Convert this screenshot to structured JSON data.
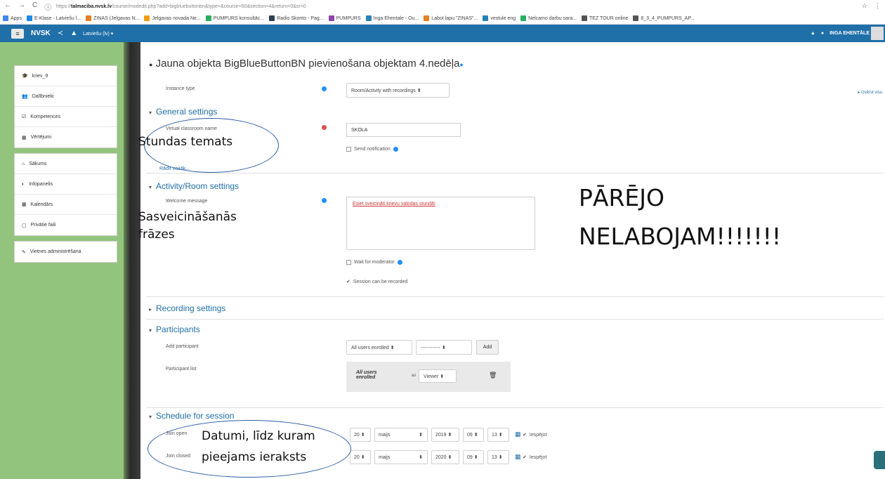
{
  "browser": {
    "nav_icons": [
      "←",
      "→",
      "C",
      "ⓘ"
    ],
    "url_prefix": "https://",
    "url_host": "talmaciba.nvsk.lv",
    "url_path": "/course/modedit.php?add=bigbluebuttonbn&type=&course=50&section=4&return=0&sr=0",
    "right_icons": [
      "☆",
      "⋮"
    ],
    "bookmarks": [
      {
        "label": "Apps",
        "color": "#4285f4"
      },
      {
        "label": "E-Klase - Latviešu l...",
        "color": "#1e88e5"
      },
      {
        "label": "ZIŅAS (Jelgavas N...",
        "color": "#e67e22"
      },
      {
        "label": "Jelgavas novada Ne...",
        "color": "#f39c12"
      },
      {
        "label": "PUMPURS konsultāc...",
        "color": "#27ae60"
      },
      {
        "label": "Radio Skonto - Pag...",
        "color": "#2c3e50"
      },
      {
        "label": "PUMPURS",
        "color": "#8e44ad"
      },
      {
        "label": "Inga Ehentale - Ou...",
        "color": "#2980b9"
      },
      {
        "label": "Labot lapu \"ZIŅAS\"...",
        "color": "#e67e22"
      },
      {
        "label": "vestule eng",
        "color": "#2980b9"
      },
      {
        "label": "Nelcamo darbu sara...",
        "color": "#27ae60"
      },
      {
        "label": "TEZ TOUR online",
        "color": "#555"
      },
      {
        "label": "8_3_4_PUMPURS_AP...",
        "color": "#555"
      }
    ]
  },
  "navbar": {
    "menu_icon": "≡",
    "brand": "NVSK",
    "share_icon": "≺",
    "site_icon": "▲",
    "language": "Latviešu (lv) ▾",
    "bell": "▲",
    "chat": "●",
    "user_name": "INGA EHENTĀLE"
  },
  "sidebar": {
    "block1": [
      {
        "icon": "🎓",
        "label": "kriev_9"
      },
      {
        "icon": "👥",
        "label": "Dalībnieki"
      },
      {
        "icon": "☑",
        "label": "Kompetences"
      },
      {
        "icon": "▦",
        "label": "Vērtējumi"
      }
    ],
    "block2": [
      {
        "icon": "⌂",
        "label": "Sākums"
      },
      {
        "icon": "◐",
        "label": "Infopanelis"
      },
      {
        "icon": "▦",
        "label": "Kalendārs"
      },
      {
        "icon": "▢",
        "label": "Privātie faili"
      }
    ],
    "block3": [
      {
        "icon": "✎",
        "label": "Vietnes administrēšana"
      }
    ]
  },
  "form": {
    "title": "Jauna objekta BigBlueButtonBN pievienošana objektam 4.nedēļa",
    "expand_all": "▸ Izvērst visu",
    "instance_type_label": "Instance type",
    "instance_type_value": "Room/Activity with recordings ⬍",
    "general_settings": "General settings",
    "virtual_classroom_label": "Virtual classroom name",
    "virtual_classroom_value": "SKOLA",
    "send_notification": "Send notification",
    "edit_more": "Rādīt vairāk...",
    "activity_settings": "Activity/Room settings",
    "welcome_label": "Welcome message",
    "welcome_value": "Esiet sveicināti krievu valodas stundā!",
    "wait_moderator": "Wait for moderator",
    "session_recorded": "Session can be recorded",
    "recording_settings": "Recording settings",
    "participants": "Participants",
    "add_participant_label": "Add participant",
    "add_participant_select1": "All users enrolled ⬍",
    "add_participant_select2": "------------ ⬍",
    "add_button": "Add",
    "participant_list_label": "Participant list",
    "participant_name": "All users enrolled",
    "participant_as": "as",
    "participant_role": "Viewer  ⬍",
    "trash_icon": "🗑",
    "schedule": "Schedule for session",
    "join_open_label": "Join open",
    "join_closed_label": "Join closed",
    "join_open": {
      "day": "20 ⬍",
      "month": "maijs",
      "month_arrow": "⬍",
      "year": "2019 ⬍",
      "hour": "09 ⬍",
      "minute": "13 ⬍",
      "enable": "Iespējot"
    },
    "join_closed": {
      "day": "20 ⬍",
      "month": "maijs",
      "month_arrow": "⬍",
      "year": "2020 ⬍",
      "hour": "09 ⬍",
      "minute": "13 ⬍",
      "enable": "Iespējot"
    },
    "calendar_icon": "▦",
    "chevron_down": "▾",
    "chevron_right": "▸",
    "check_mark": "✔"
  },
  "annotations": {
    "topic": "Stundas temats",
    "greetings_line1": "Sasveicināšanās",
    "greetings_line2": "frāzes",
    "rest_line1": "PĀRĒJO",
    "rest_line2": "NELABOJAM!!!!!!!",
    "dates_line1": "Datumi, līdz kuram",
    "dates_line2": "pieejams ieraksts"
  }
}
